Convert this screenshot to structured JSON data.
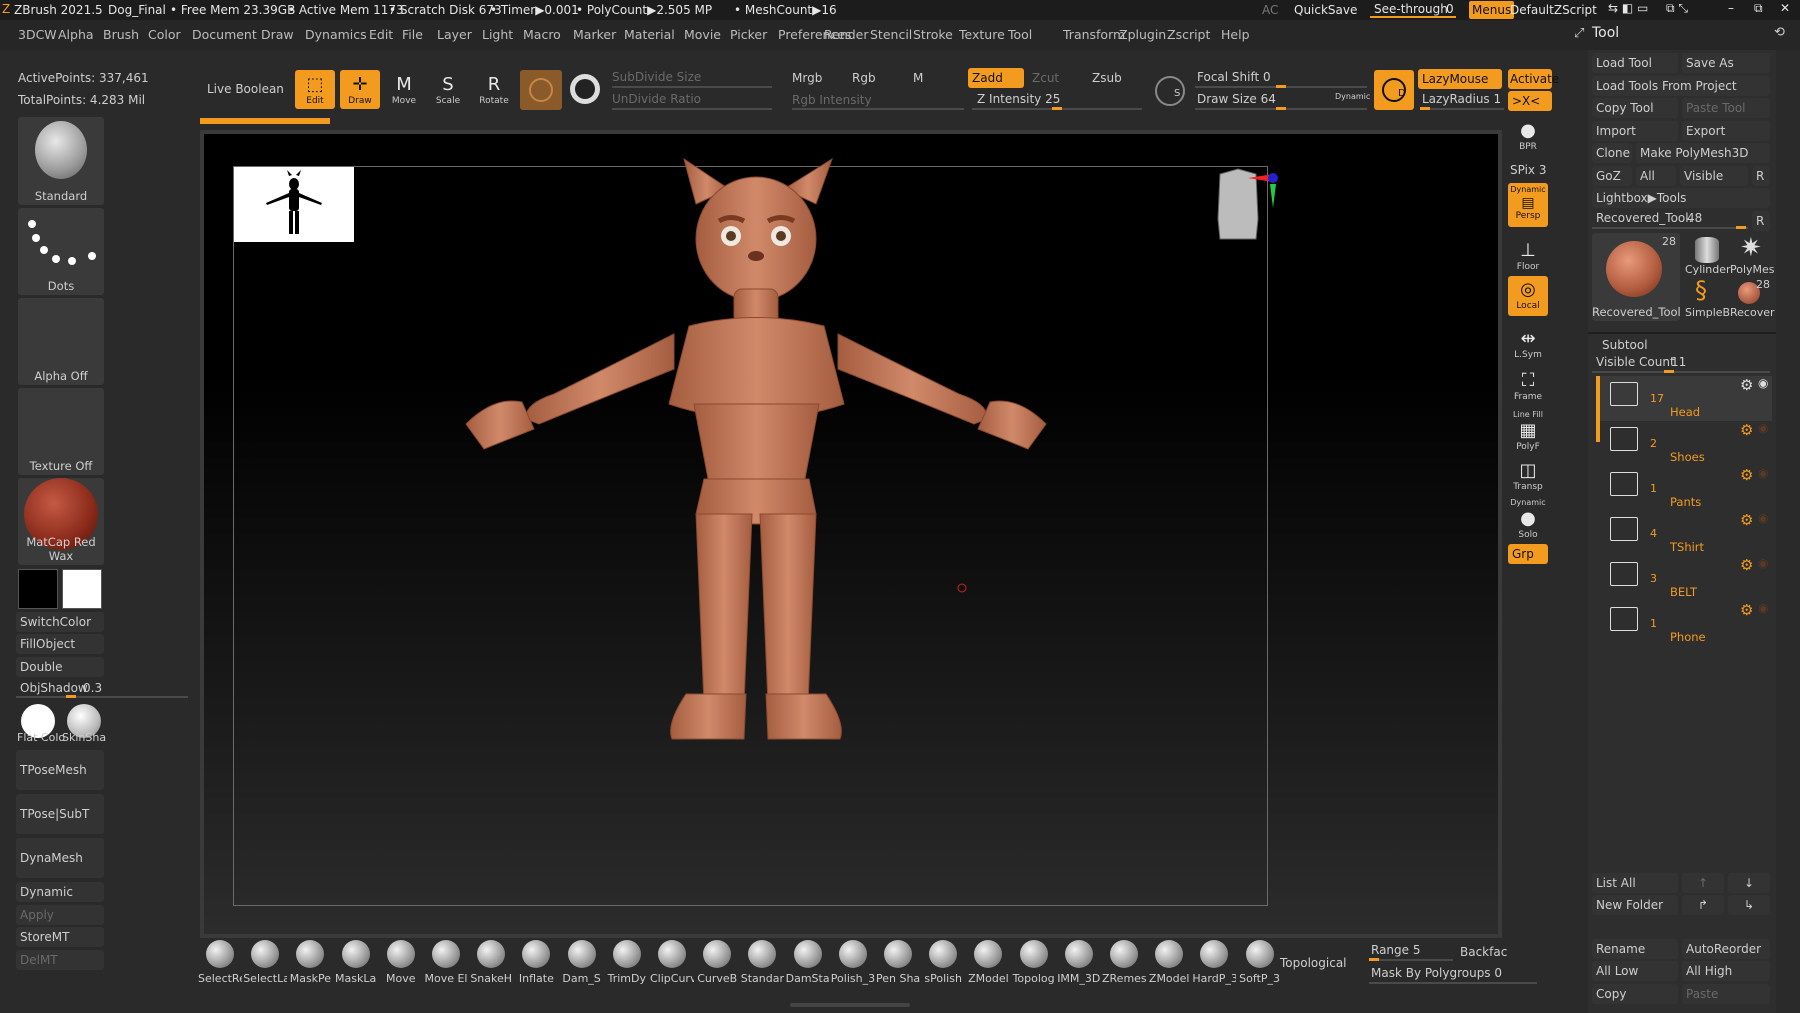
{
  "titlebar": {
    "app": "ZBrush 2021.5",
    "doc": "Dog_Final",
    "freemem": "• Free Mem 23.39GB",
    "activemem": "• Active Mem 1173",
    "scratch": "• Scratch Disk 673",
    "timer": "• Timer▶0.001",
    "polycount": "• PolyCount▶2.505 MP",
    "meshcount": "• MeshCount▶16",
    "ac": "AC",
    "quicksave": "QuickSave",
    "seethrough": "See-through",
    "seethrough_val": "0",
    "menus": "Menus",
    "defaultzscript": "DefaultZScript"
  },
  "menus": [
    "3DCW",
    "Alpha",
    "Brush",
    "Color",
    "Document",
    "Draw",
    "Dynamics",
    "Edit",
    "File",
    "Layer",
    "Light",
    "Macro",
    "Marker",
    "Material",
    "Movie",
    "Picker",
    "Preferences",
    "Render",
    "Stencil",
    "Stroke",
    "Texture",
    "Tool",
    "Transform",
    "Zplugin",
    "Zscript",
    "Help"
  ],
  "stats": {
    "active": "ActivePoints: 337,461",
    "total": "TotalPoints: 4.283 Mil"
  },
  "toolbar": {
    "live_boolean": "Live Boolean",
    "edit": "Edit",
    "draw": "Draw",
    "move": "Move",
    "scale": "Scale",
    "rotate": "Rotate",
    "subdivide": "SubDivide Size",
    "undivide": "UnDivide Ratio",
    "mrgb": "Mrgb",
    "rgb": "Rgb",
    "m": "M",
    "rgb_intensity": "Rgb Intensity",
    "zadd": "Zadd",
    "zcut": "Zcut",
    "zsub": "Zsub",
    "z_intensity": "Z Intensity 25",
    "focal_shift": "Focal Shift 0",
    "draw_size": "Draw Size 64",
    "dynamic": "Dynamic",
    "lazymouse": "LazyMouse",
    "lazyradius": "LazyRadius 1",
    "activate": "Activate",
    "xc": ">X<"
  },
  "leftpanel": {
    "standard": "Standard",
    "dots": "Dots",
    "alpha_off": "Alpha Off",
    "texture_off": "Texture Off",
    "matcap": "MatCap Red Wax",
    "switchcolor": "SwitchColor",
    "fillobject": "FillObject",
    "double": "Double",
    "objshadow": "ObjShadow",
    "objshadow_val": "0.3",
    "flatcolor": "Flat Colo",
    "skinshade": "SkinSha",
    "tposemesh": "TPoseMesh",
    "tpose_subt": "TPose|SubT",
    "dynamesh": "DynaMesh",
    "dynamic": "Dynamic",
    "apply": "Apply",
    "storemt": "StoreMT",
    "delmt": "DelMT"
  },
  "rightshelf": {
    "bpr": "BPR",
    "spix": "SPix 3",
    "dynamic": "Dynamic",
    "persp": "Persp",
    "floor": "Floor",
    "local": "Local",
    "lsym": "L.Sym",
    "frame": "Frame",
    "linefill": "Line Fill",
    "polyf": "PolyF",
    "transp": "Transp",
    "solo_dyn": "Dynamic",
    "solo": "Solo",
    "grp": "Grp"
  },
  "toolpanel": {
    "title": "Tool",
    "load_tool": "Load Tool",
    "save_as": "Save As",
    "load_from_project": "Load Tools From Project",
    "copy_tool": "Copy Tool",
    "paste_tool": "Paste Tool",
    "import": "Import",
    "export": "Export",
    "clone": "Clone",
    "make_polymesh": "Make PolyMesh3D",
    "goz": "GoZ",
    "all": "All",
    "visible": "Visible",
    "r": "R",
    "lightbox": "Lightbox▶Tools",
    "recovered": "Recovered_Tool.",
    "recovered_val": "48",
    "thumb_count": "28",
    "thumb_big": "Recovered_Tool",
    "cylinder": "Cylinder",
    "polymesh": "PolyMes",
    "simpleb": "SimpleB",
    "recover": "Recover",
    "recover_count": "28",
    "subtool": "Subtool",
    "visible_count": "Visible Count",
    "visible_count_val": "11",
    "list_all": "List All",
    "new_folder": "New Folder",
    "rename": "Rename",
    "autoreorder": "AutoReorder",
    "all_low": "All Low",
    "all_high": "All High",
    "copy": "Copy",
    "paste": "Paste"
  },
  "subtools": [
    {
      "count": "17",
      "name": "Head"
    },
    {
      "count": "2",
      "name": "Shoes"
    },
    {
      "count": "1",
      "name": "Pants"
    },
    {
      "count": "4",
      "name": "TShirt"
    },
    {
      "count": "3",
      "name": "BELT"
    },
    {
      "count": "1",
      "name": "Phone"
    }
  ],
  "brushes": [
    "SelectRe",
    "SelectLa",
    "MaskPe",
    "MaskLa",
    "Move",
    "Move El",
    "SnakeH",
    "Inflate",
    "Dam_S",
    "TrimDy",
    "ClipCurv",
    "CurveB",
    "Standar",
    "DamSta",
    "Polish_3 Pen A",
    "Pen Sha",
    "sPolish",
    "ZModel",
    "Topolog",
    "IMM_3D",
    "ZRemes",
    "ZModel",
    "HardP_3",
    "SoftP_3"
  ],
  "bottom": {
    "topological": "Topological",
    "range": "Range 5",
    "backface": "Backfac",
    "mask_polygroups": "Mask By Polygroups 0"
  },
  "colors": {
    "accent": "#f39b1f",
    "bg": "#2a2a2a",
    "skin": "#c07a5c"
  }
}
